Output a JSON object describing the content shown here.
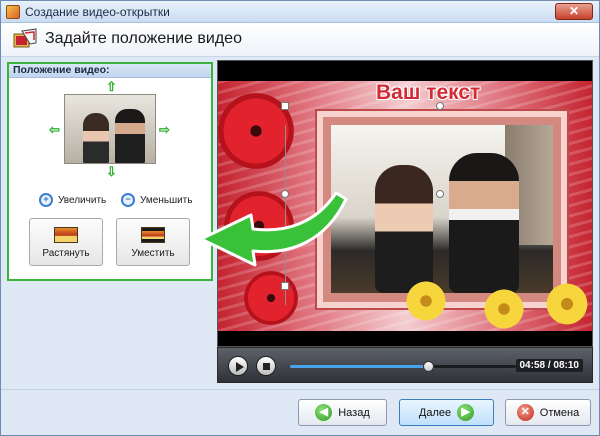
{
  "window": {
    "title": "Создание видео-открытки",
    "close_symbol": "✕"
  },
  "header": {
    "title": "Задайте положение видео"
  },
  "left_panel": {
    "title": "Положение видео:",
    "zoom_in_label": "Увеличить",
    "zoom_out_label": "Уменьшить",
    "stretch_label": "Растянуть",
    "fit_label": "Уместить",
    "arrows": {
      "up": "⇧",
      "down": "⇩",
      "left": "⇦",
      "right": "⇨"
    }
  },
  "preview": {
    "caption": "Ваш текст"
  },
  "player": {
    "time": "04:58 / 08:10",
    "progress": 0.61
  },
  "footer": {
    "back_label": "Назад",
    "next_label": "Далее",
    "cancel_label": "Отмена",
    "back_icon": "◀",
    "next_icon": "▶",
    "cancel_icon": "✕"
  },
  "colors": {
    "highlight_border": "#3cb43c",
    "caption": "#d22b36",
    "progress": "#4aa3e8"
  }
}
